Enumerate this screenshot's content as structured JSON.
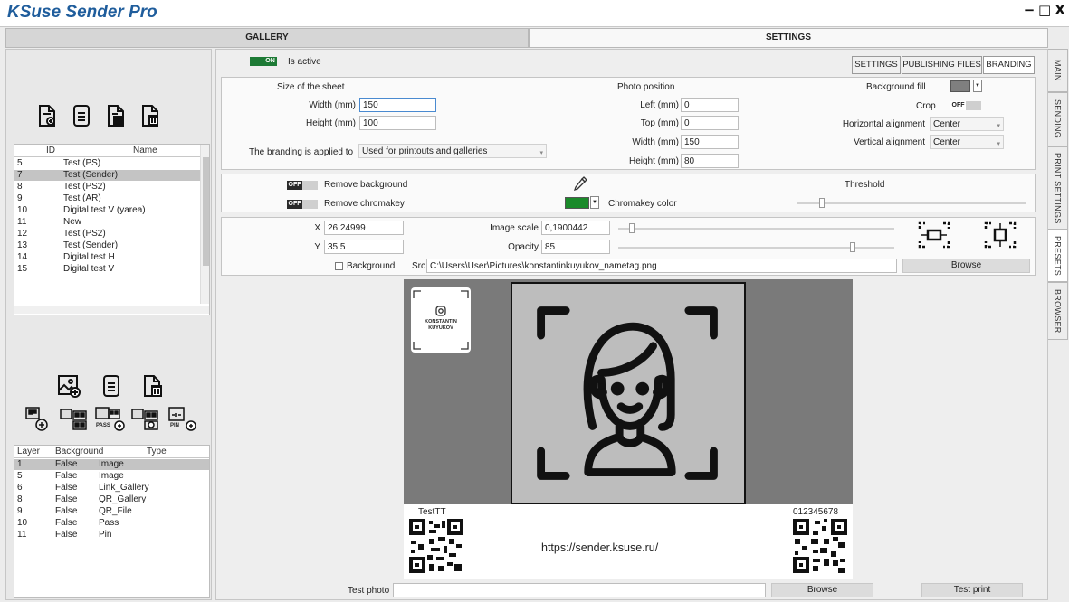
{
  "app": {
    "title": "KSuse Sender Pro"
  },
  "window_controls": {
    "minimize": "−",
    "maximize": "□",
    "close": "X"
  },
  "main_tabs": {
    "gallery": "GALLERY",
    "settings": "SETTINGS"
  },
  "side_tabs": [
    "MAIN",
    "SENDING",
    "PRINT SETTINGS",
    "PRESETS",
    "BROWSER"
  ],
  "left": {
    "presets_grid": {
      "headers": {
        "id": "ID",
        "name": "Name"
      },
      "rows": [
        {
          "id": "5",
          "name": "Test (PS)"
        },
        {
          "id": "7",
          "name": "Test (Sender)"
        },
        {
          "id": "8",
          "name": "Test (PS2)"
        },
        {
          "id": "9",
          "name": "Test (AR)"
        },
        {
          "id": "10",
          "name": "Digital test V (yarea)"
        },
        {
          "id": "11",
          "name": "New"
        },
        {
          "id": "12",
          "name": "Test (PS2)"
        },
        {
          "id": "13",
          "name": "Test (Sender)"
        },
        {
          "id": "14",
          "name": "Digital test H"
        },
        {
          "id": "15",
          "name": "Digital test V"
        }
      ],
      "selected_index": 1
    },
    "layers_grid": {
      "headers": {
        "layer": "Layer",
        "background": "Background",
        "type": "Type"
      },
      "rows": [
        {
          "layer": "1",
          "background": "False",
          "type": "Image"
        },
        {
          "layer": "5",
          "background": "False",
          "type": "Image"
        },
        {
          "layer": "6",
          "background": "False",
          "type": "Link_Gallery"
        },
        {
          "layer": "8",
          "background": "False",
          "type": "QR_Gallery"
        },
        {
          "layer": "9",
          "background": "False",
          "type": "QR_File"
        },
        {
          "layer": "10",
          "background": "False",
          "type": "Pass"
        },
        {
          "layer": "11",
          "background": "False",
          "type": "Pin"
        }
      ],
      "selected_index": 0
    },
    "preset_icons": [
      "add-document-icon",
      "document-icon",
      "copy-document-icon",
      "delete-document-icon"
    ],
    "layer_icons_row1": [
      "add-image-icon",
      "document-icon",
      "delete-document-icon"
    ],
    "layer_icons_row2": [
      "add-link-gallery-icon",
      "add-qr-gallery-icon",
      "add-pass-icon",
      "add-qr-file-icon",
      "add-pin-icon"
    ],
    "icon_labels": {
      "pass": "PASS",
      "pin": "PIN"
    }
  },
  "active": {
    "toggle": "ON",
    "label": "Is active"
  },
  "subtabs": [
    "SETTINGS",
    "PUBLISHING FILES",
    "BRANDING"
  ],
  "sheet": {
    "header": "Size of the sheet",
    "width_label": "Width (mm)",
    "width_value": "150",
    "height_label": "Height (mm)",
    "height_value": "100",
    "applied_label": "The branding is applied to",
    "applied_value": "Used for printouts and galleries"
  },
  "photo_position": {
    "header": "Photo position",
    "left_label": "Left (mm)",
    "left_value": "0",
    "top_label": "Top (mm)",
    "top_value": "0",
    "width_label": "Width (mm)",
    "width_value": "150",
    "height_label": "Height (mm)",
    "height_value": "80"
  },
  "background_fill": {
    "label": "Background fill",
    "color": "#7f7f7f",
    "crop_label": "Crop",
    "crop_toggle": "OFF",
    "h_align_label": "Horizontal alignment",
    "h_align_value": "Center",
    "v_align_label": "Vertical alignment",
    "v_align_value": "Center"
  },
  "chroma": {
    "remove_bg_toggle": "OFF",
    "remove_bg_label": "Remove background",
    "remove_chroma_toggle": "OFF",
    "remove_chroma_label": "Remove chromakey",
    "chroma_color": "#1a8a2a",
    "chroma_label": "Chromakey color",
    "threshold_label": "Threshold"
  },
  "layer": {
    "x_label": "X",
    "x_value": "26,24999",
    "y_label": "Y",
    "y_value": "35,5",
    "background_label": "Background",
    "scale_label": "Image scale",
    "scale_value": "0,1900442",
    "opacity_label": "Opacity",
    "opacity_value": "85",
    "src_label": "Src",
    "src_value": "C:\\Users\\User\\Pictures\\konstantinkuyukov_nametag.png",
    "browse": "Browse"
  },
  "preview": {
    "nametag_line1": "KONSTANTIN",
    "nametag_line2": "KUYUKOV",
    "footer_left_label": "TestTT",
    "footer_url": "https://sender.ksuse.ru/",
    "footer_right_label": "012345678"
  },
  "bottom": {
    "test_photo_label": "Test photo",
    "test_photo_value": "",
    "browse": "Browse",
    "test_print": "Test print"
  },
  "colors": {
    "brand": "#1f5d9c",
    "on_green": "#1d7a35",
    "selected_row": "#c4c4c4"
  }
}
